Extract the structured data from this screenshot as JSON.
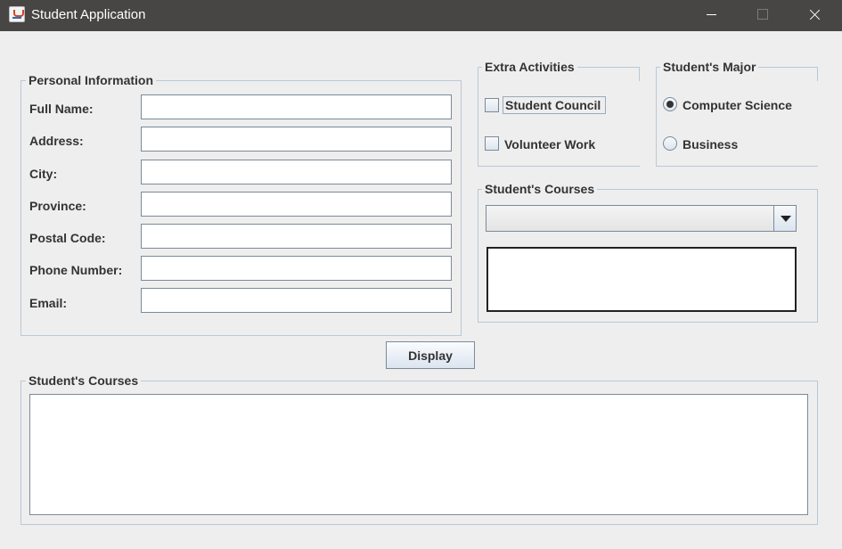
{
  "window": {
    "title": "Student Application"
  },
  "personal_info": {
    "legend": "Personal Information",
    "fields": [
      {
        "label": "Full Name:",
        "value": ""
      },
      {
        "label": "Address:",
        "value": ""
      },
      {
        "label": "City:",
        "value": ""
      },
      {
        "label": "Province:",
        "value": ""
      },
      {
        "label": "Postal Code:",
        "value": ""
      },
      {
        "label": "Phone Number:",
        "value": ""
      },
      {
        "label": "Email:",
        "value": ""
      }
    ]
  },
  "extra_activities": {
    "legend": "Extra Activities",
    "options": [
      {
        "label": "Student Council",
        "checked": false
      },
      {
        "label": "Volunteer Work",
        "checked": false
      }
    ]
  },
  "major": {
    "legend": "Student's Major",
    "options": [
      {
        "label": "Computer Science",
        "selected": true
      },
      {
        "label": "Business",
        "selected": false
      }
    ]
  },
  "courses_selector": {
    "legend": "Student's Courses",
    "combo_value": "",
    "list_text": ""
  },
  "display_button": {
    "label": "Display"
  },
  "output": {
    "legend": "Student's Courses",
    "text": ""
  }
}
